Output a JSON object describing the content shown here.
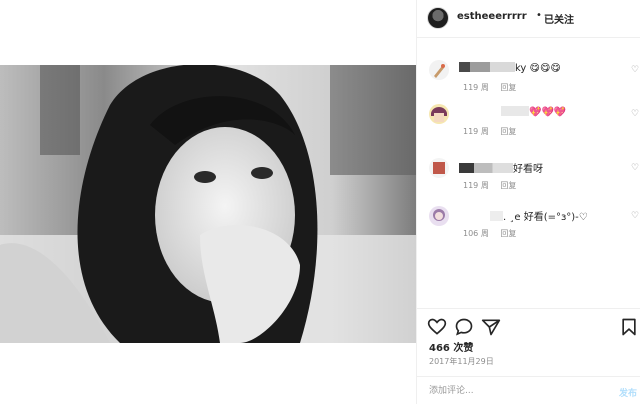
{
  "post": {
    "username": "estheeerrrrr",
    "separator": "•",
    "follow_status": "已关注",
    "photo_description": "black and white portrait photo"
  },
  "comments": [
    {
      "text_suffix": "ky 😋😋😋",
      "age": "119 周",
      "reply": "回复",
      "avatar_icon": "dropper-avatar-icon"
    },
    {
      "text_suffix": "💖💖💖",
      "age": "119 周",
      "reply": "回复",
      "avatar_icon": "pink-hair-avatar-icon"
    },
    {
      "text_suffix": "好看呀",
      "age": "119 周",
      "reply": "回复",
      "avatar_icon": "red-square-avatar-icon"
    },
    {
      "text_suffix": ". ¸e 好看(=°з°)-♡",
      "age": "106 周",
      "reply": "回复",
      "avatar_icon": "girl-avatar-icon"
    }
  ],
  "actions": {
    "like_icon": "heart-outline-icon",
    "comment_icon": "speech-bubble-icon",
    "share_icon": "paper-plane-icon",
    "save_icon": "bookmark-icon"
  },
  "likes": "466 次赞",
  "date": "2017年11月29日",
  "comment_box": {
    "placeholder": "添加评论...",
    "post_label": "发布"
  },
  "colors": {
    "link_disabled": "#b2dffc",
    "meta_gray": "#8e8e8e",
    "divider": "#efefef"
  }
}
